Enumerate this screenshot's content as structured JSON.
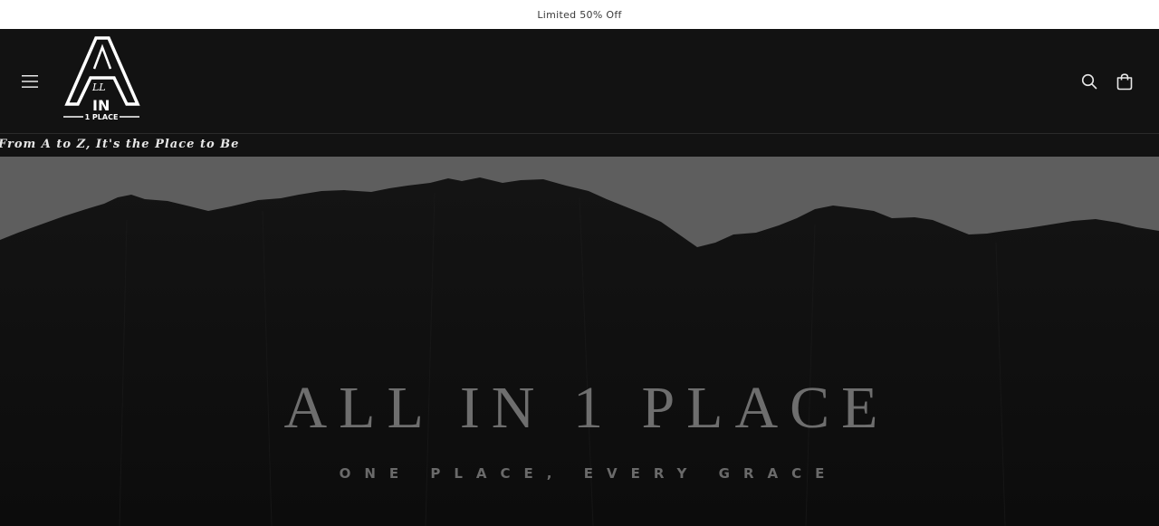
{
  "announcement": {
    "text": "Limited 50% Off"
  },
  "header": {
    "logo": {
      "big_letter": "A",
      "middle": "IN",
      "bottom": "1 PLACE",
      "script": "LL"
    },
    "icons": {
      "menu": "hamburger-menu-icon",
      "search": "search-icon",
      "cart": "shopping-bag-icon"
    }
  },
  "tagline": {
    "text": "From A to Z, It's the Place to Be"
  },
  "hero": {
    "title": "ALL IN 1 PLACE",
    "subtitle": "ONE PLACE, EVERY GRACE"
  },
  "colors": {
    "announcement_bg": "#ffffff",
    "header_bg": "#121212",
    "hero_sky": "#5e5e5e",
    "hero_rock": "#151515",
    "hero_text": "#6e6e6e"
  }
}
